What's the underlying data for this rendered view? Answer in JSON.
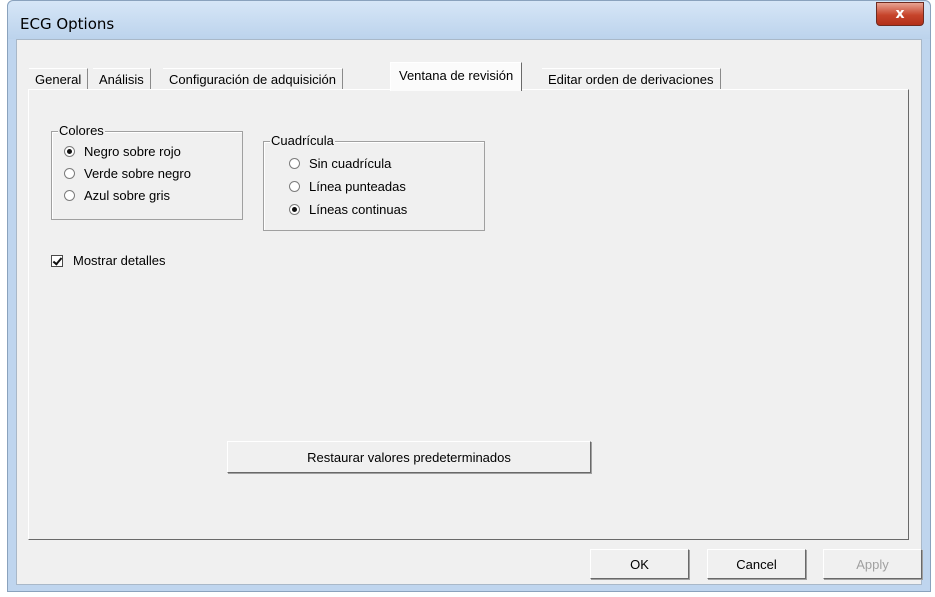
{
  "window": {
    "title": "ECG Options",
    "close_label": "x"
  },
  "tabs": [
    {
      "label": "General"
    },
    {
      "label": "Análisis"
    },
    {
      "label": "Configuración de adquisición"
    },
    {
      "label": "Ventana de revisión",
      "active": true
    },
    {
      "label": "Editar orden de derivaciones"
    }
  ],
  "colores": {
    "legend": "Colores",
    "options": [
      {
        "label": "Negro sobre rojo",
        "selected": true
      },
      {
        "label": "Verde sobre negro",
        "selected": false
      },
      {
        "label": "Azul sobre gris",
        "selected": false
      }
    ]
  },
  "cuadricula": {
    "legend": "Cuadrícula",
    "options": [
      {
        "label": "Sin cuadrícula",
        "selected": false
      },
      {
        "label": "Línea punteadas",
        "selected": false
      },
      {
        "label": "Líneas continuas",
        "selected": true
      }
    ]
  },
  "mostrar_detalles": {
    "label": "Mostrar detalles",
    "checked": true
  },
  "restore_label": "Restaurar valores predeterminados",
  "footer": {
    "ok": "OK",
    "cancel": "Cancel",
    "apply": "Apply"
  }
}
